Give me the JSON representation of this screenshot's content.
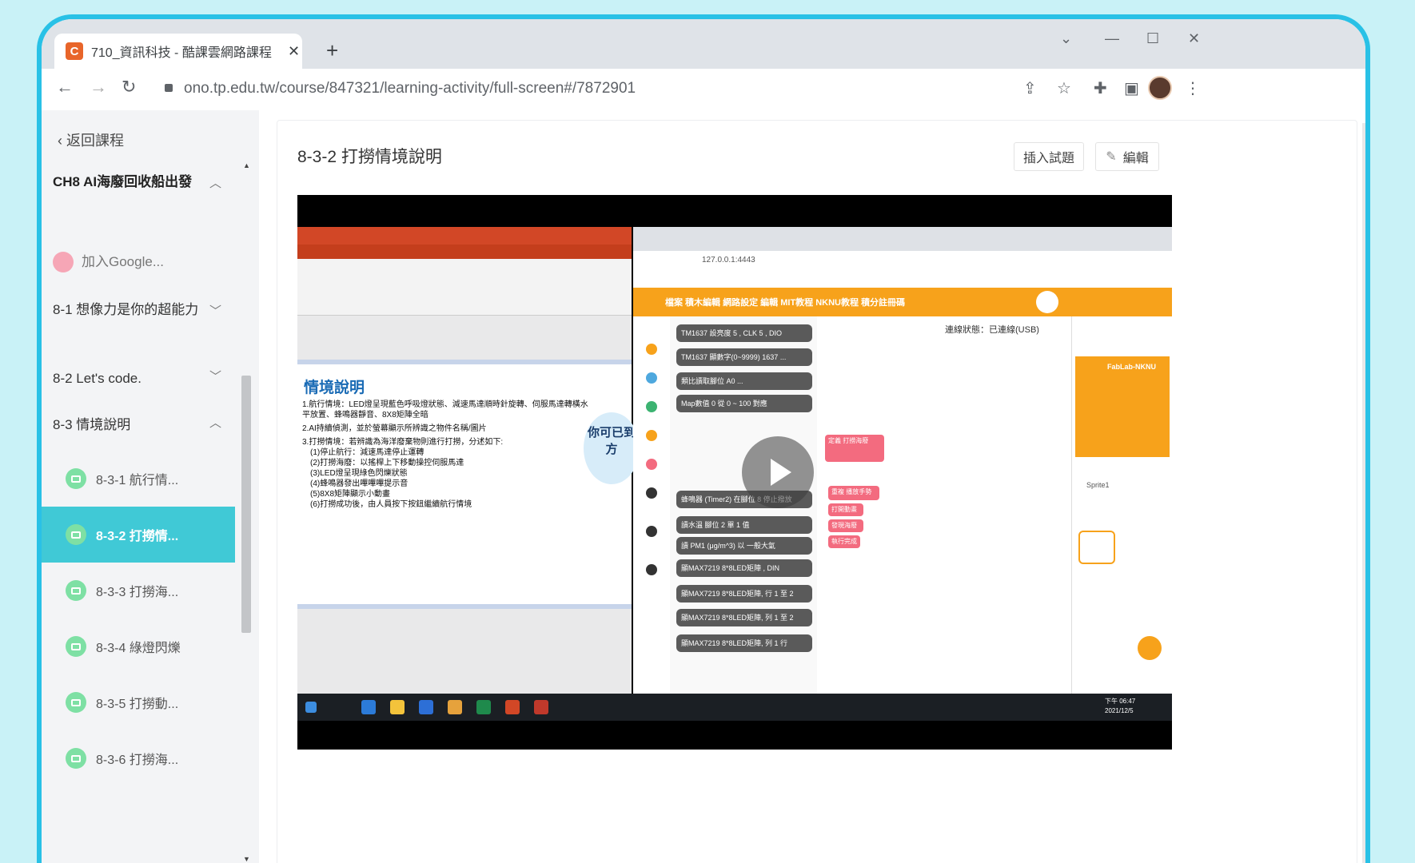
{
  "browser": {
    "tab_title": "710_資訊科技 - 酷課雲網路課程",
    "tab_close": "✕",
    "new_tab": "+",
    "url": "ono.tp.edu.tw/course/847321/learning-activity/full-screen#/7872901"
  },
  "sidebar": {
    "back_label": "返回課程",
    "chapter_title": "CH8 AI海廢回收船出發",
    "items": [
      {
        "label": "加入Google..."
      },
      {
        "label": "8-1 想像力是你的超能力"
      },
      {
        "label": "8-2 Let's code."
      },
      {
        "label": "8-3 情境說明"
      }
    ],
    "sub_items": [
      {
        "label": "8-3-1 航行情..."
      },
      {
        "label": "8-3-2 打撈情..."
      },
      {
        "label": "8-3-3 打撈海..."
      },
      {
        "label": "8-3-4 綠燈閃爍"
      },
      {
        "label": "8-3-5 打撈動..."
      },
      {
        "label": "8-3-6 打撈海..."
      }
    ]
  },
  "main": {
    "title": "8-3-2 打撈情境說明",
    "insert_button": "插入試題",
    "edit_button": "編輯"
  },
  "video": {
    "slide_title": "情境說明",
    "slide_lines": [
      "1.航行情境：LED燈呈現藍色呼吸燈狀態、減速馬達順時針旋轉、伺服馬達轉橫水平放置、蜂鳴器靜音、8X8矩陣全暗",
      "2.AI持續偵測，並於螢幕顯示所辨識之物件名稱/圖片",
      "3.打撈情境：若辨識為海洋廢棄物則進行打撈，分述如下:",
      "(1)停止航行：減速馬達停止運轉",
      "(2)打撈海廢：以搖桿上下移動操控伺服馬達",
      "(3)LED燈呈現綠色閃爍狀態",
      "(4)蜂鳴器發出嗶嗶嗶提示音",
      "(5)8X8矩陣顯示小動畫",
      "(6)打撈成功後，由人員按下按鈕繼續航行情境"
    ],
    "bubble_text": "你可已到方",
    "status_text": "連線狀態：已連線(USB)",
    "inner_url": "127.0.0.1:4443",
    "inner_menu": "檔案   積木編輯   網路設定   編輯   MIT教程   NKNU教程   積分註冊碼",
    "blocks": [
      "TM1637 設亮度 5 , CLK 5 , DIO",
      "TM1637 顯數字(0~9999) 1637 ...",
      "類比讀取腳位 A0 ...",
      "Map數值 0 從 0 ~ 100 對應",
      "蜂鳴器 (Timer2) 在腳位 8 停止撥放",
      "讀水溫 腳位 2 單 1 值",
      "讀 PM1 (μg/m^3) 以 一般大氣",
      "顯MAX7219 8*8LED矩陣 , DIN",
      "顯MAX7219 8*8LED矩陣, 行 1 至 2",
      "顯MAX7219 8*8LED矩陣, 列 1 至 2",
      "顯MAX7219 8*8LED矩陣, 列 1 行"
    ],
    "pink_blocks": [
      "定義 打撈海廢",
      "重複 播放手勢",
      "打開動畫",
      "發現海廢",
      "執行完成"
    ],
    "stage_label": "FabLab-NKNU",
    "sprite_label": "Sprite1",
    "clock": "下午 06:47",
    "date": "2021/12/5"
  },
  "colors": {
    "frame_border": "#29c1e6",
    "active_item_bg": "#40c9d6",
    "play_icon": "#7ee0a4",
    "ppt_red": "#d24726",
    "scratch_orange": "#f7a21b"
  }
}
